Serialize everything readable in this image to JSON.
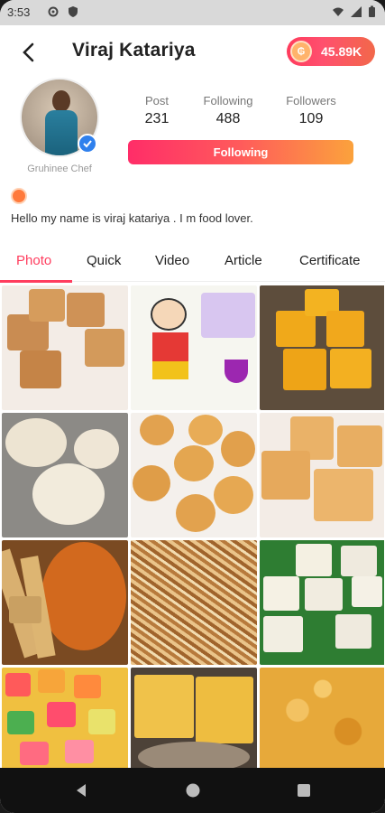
{
  "status_bar": {
    "time": "3:53"
  },
  "header": {
    "name": "Viraj Katariya",
    "coins": "45.89K"
  },
  "profile": {
    "role": "Gruhinee Chef",
    "bio": "Hello my name is viraj katariya . I m food lover.",
    "stats": [
      {
        "label": "Post",
        "value": "231"
      },
      {
        "label": "Following",
        "value": "488"
      },
      {
        "label": "Followers",
        "value": "109"
      }
    ],
    "follow_button": "Following"
  },
  "tabs": [
    "Photo",
    "Quick",
    "Video",
    "Article",
    "Certificate"
  ],
  "colors": {
    "accent": "#ff3d5e",
    "gradient_start": "#ff2d68",
    "gradient_end": "#fba23c"
  }
}
